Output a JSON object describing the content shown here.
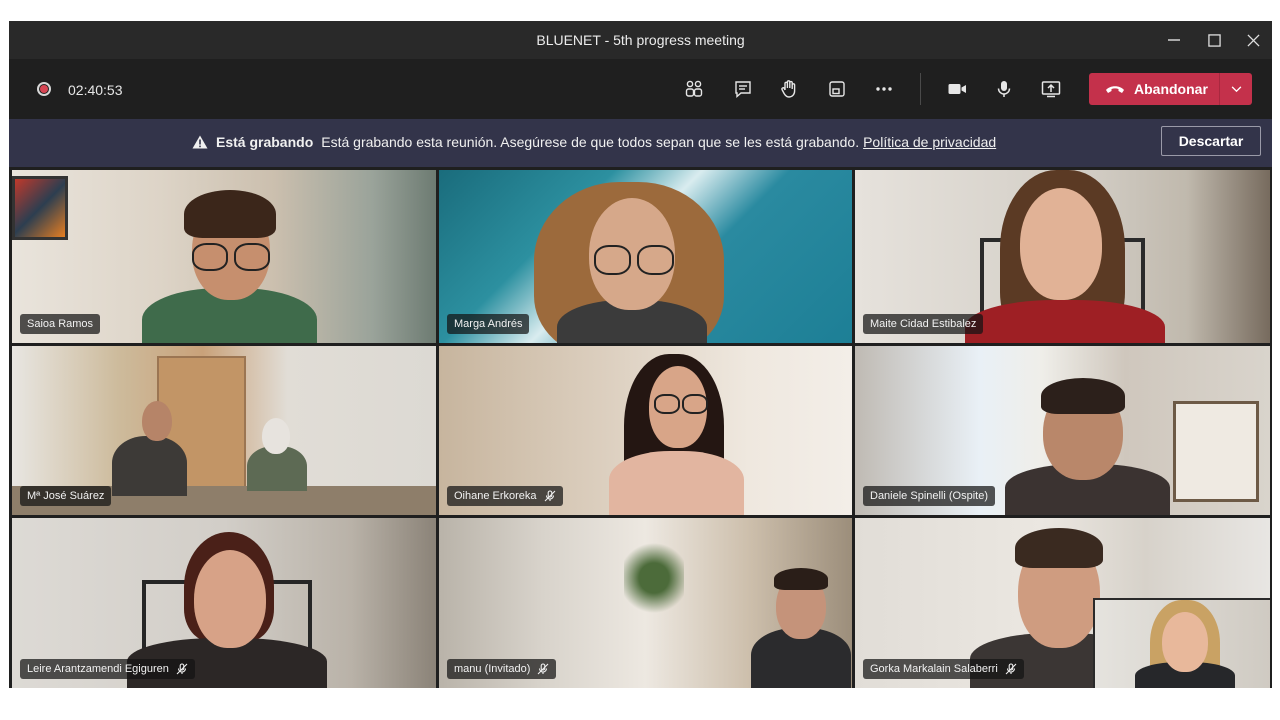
{
  "window": {
    "title": "BLUENET - 5th progress meeting",
    "controls": {
      "minimize": "—",
      "maximize": "☐",
      "close": "✕"
    }
  },
  "toolbar": {
    "timer": "02:40:53",
    "icons": [
      "participants-icon",
      "chat-icon",
      "raise-hand-icon",
      "share-tray-icon",
      "more-options-icon",
      "camera-icon",
      "microphone-icon",
      "share-screen-icon"
    ],
    "leave_label": "Abandonar"
  },
  "banner": {
    "title": "Está grabando",
    "message": "Está grabando esta reunión. Asegúrese de que todos sepan que se les está grabando.",
    "link": "Política de privacidad",
    "dismiss_label": "Descartar"
  },
  "participants": [
    {
      "name": "Saioa Ramos",
      "muted": false
    },
    {
      "name": "Marga Andrés",
      "muted": false
    },
    {
      "name": "Maite Cidad Estibalez",
      "muted": false
    },
    {
      "name": "Mª José Suárez",
      "muted": false
    },
    {
      "name": "Oihane Erkoreka",
      "muted": true
    },
    {
      "name": "Daniele Spinelli (Ospite)",
      "muted": false
    },
    {
      "name": "Leire Arantzamendi Egiguren",
      "muted": true
    },
    {
      "name": "manu (Invitado)",
      "muted": true
    },
    {
      "name": "Gorka Markalain Salaberri",
      "muted": true
    }
  ],
  "colors": {
    "leave_button": "#c4314b",
    "banner_bg": "#33344a",
    "recording_dot": "#d74654",
    "titlebar_bg": "#292929"
  }
}
